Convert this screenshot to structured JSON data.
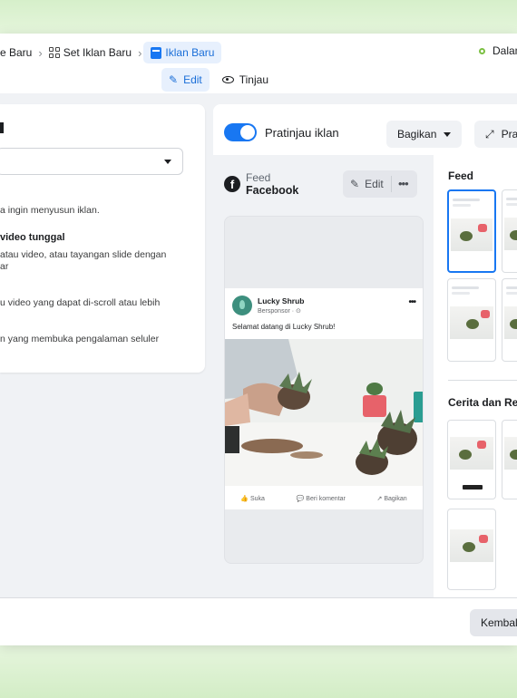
{
  "breadcrumb": {
    "items": [
      {
        "label": "e Baru"
      },
      {
        "label": "Set Iklan Baru"
      },
      {
        "label": "Iklan Baru"
      }
    ]
  },
  "status": {
    "label": "Dalan"
  },
  "modes": {
    "edit": "Edit",
    "review": "Tinjau"
  },
  "left_panel": {
    "lines": [
      "a ingin menyusun iklan.",
      "video tunggal",
      "atau video, atau tayangan slide dengan",
      "ar",
      "u video yang dapat di-scroll atau lebih",
      "n yang membuka pengalaman seluler"
    ]
  },
  "preview": {
    "toggle_label": "Pratinjau iklan",
    "share_button": "Bagikan",
    "preview_button": "Pra",
    "placement_small": "Feed",
    "placement_big": "Facebook",
    "edit_button": "Edit"
  },
  "post": {
    "page_name": "Lucky Shrub",
    "sponsored": "Bersponsor · ⊙",
    "caption": "Selamat datang di Lucky Shrub!",
    "actions": {
      "like": "Suka",
      "comment": "Beri komentar",
      "share": "Bagikan"
    }
  },
  "thumbnails": {
    "feed_title": "Feed",
    "stories_title": "Cerita dan Re"
  },
  "footer": {
    "back_button": "Kembal"
  },
  "colors": {
    "accent": "#1877f2",
    "background_green": "#e6f6dd"
  }
}
